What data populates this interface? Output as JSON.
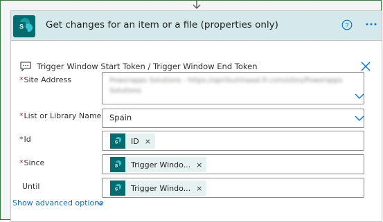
{
  "colors": {
    "accent": "#0078d4",
    "header_bg": "#d5e9ea",
    "sharepoint": "#036c70",
    "required": "#a4262c",
    "frame": "#2e7d32"
  },
  "action": {
    "title": "Get changes for an item or a file (properties only)",
    "icon": "sharepoint-icon",
    "help_icon": "help-circle-icon",
    "more_icon": "ellipsis-icon"
  },
  "info": {
    "text": "Trigger Window Start Token / Trigger Window End Token",
    "icon": "chat-bubble-icon",
    "close_icon": "close-icon"
  },
  "fields": {
    "site_address": {
      "label": "Site Address",
      "required": "*",
      "value_line1": "Powerapps Solutions - https://aprilsutmaaal.fr.com/sites/Powerapps",
      "value_line2": "Solutions"
    },
    "list_name": {
      "label": "List or Library Name",
      "required": "*",
      "value": "Spain"
    },
    "id": {
      "label": "Id",
      "required": "*",
      "token": "ID",
      "remove": "×"
    },
    "since": {
      "label": "Since",
      "required": "*",
      "token": "Trigger Windo...",
      "remove": "×"
    },
    "until": {
      "label": "Until",
      "token": "Trigger Windo...",
      "remove": "×"
    }
  },
  "advanced": {
    "label": "Show advanced options"
  }
}
